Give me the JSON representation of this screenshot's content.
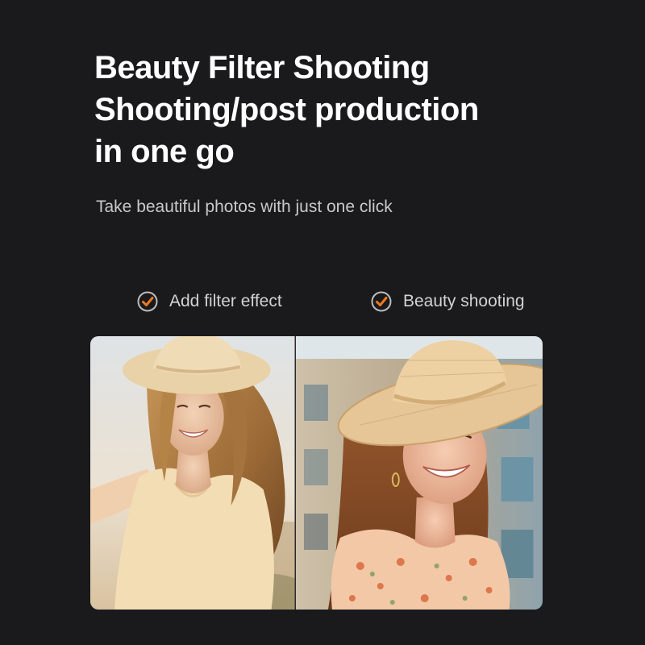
{
  "headline": {
    "line1": "Beauty Filter Shooting",
    "line2": "Shooting/post production",
    "line3": "in one go"
  },
  "subtitle": "Take beautiful photos with just one click",
  "features": [
    {
      "label": "Add filter effect",
      "icon": "check-circle-icon"
    },
    {
      "label": "Beauty shooting",
      "icon": "check-circle-icon"
    }
  ],
  "colors": {
    "background": "#1a1a1c",
    "accent": "#f07a1e",
    "headline": "#ffffff",
    "subtext": "#c9c9cb"
  },
  "photos": [
    {
      "subject": "smiling woman with sun hat taking selfie, original"
    },
    {
      "subject": "smiling woman with straw hat, beauty filtered"
    }
  ]
}
